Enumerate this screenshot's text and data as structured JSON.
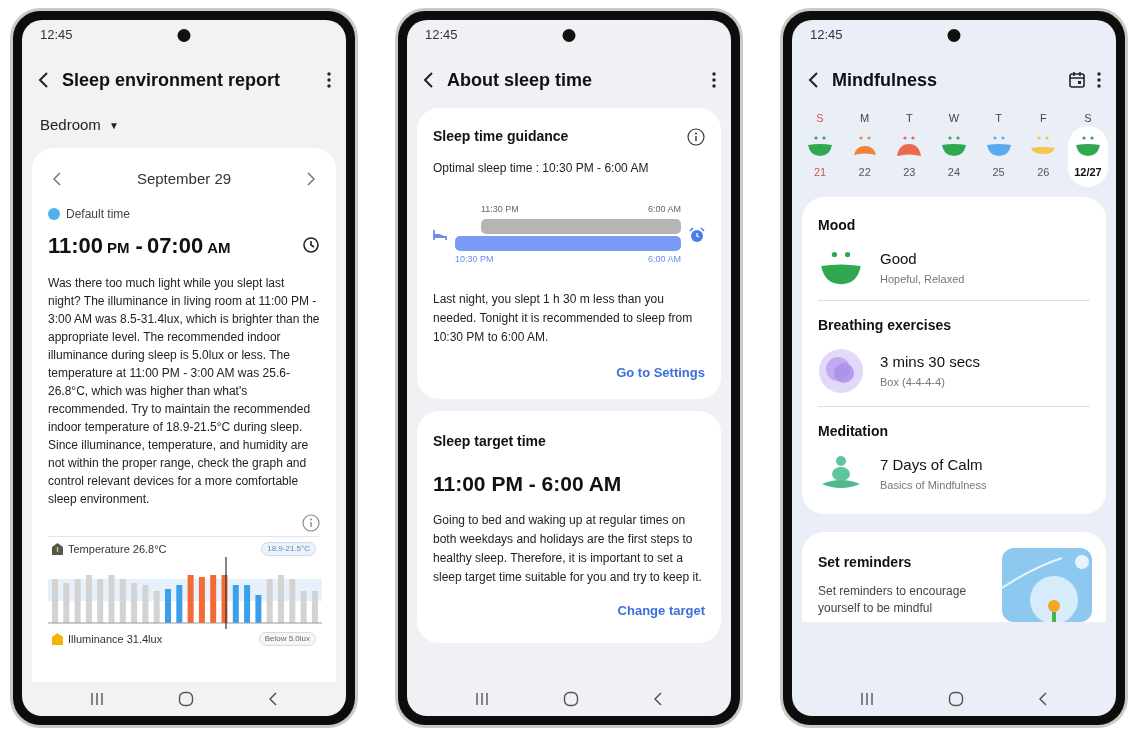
{
  "phones": [
    {
      "kind": "report",
      "status_time": "12:45",
      "title": "Sleep environment report",
      "room": "Bedroom",
      "room_caret": "▼",
      "date": "September 29",
      "default_label": "Default time",
      "time_range": {
        "start": "11:00",
        "start_period": "PM",
        "separator": "-",
        "end": "07:00",
        "end_period": "AM"
      },
      "paragraph": "Was there too much light while you slept last night? The illuminance in living room at 11:00 PM - 3:00 AM was 8.5-31.4lux, which is brighter than the appropriate level. The recommended indoor illuminance during sleep is 5.0lux or less. The temperature at 11:00 PM - 3:00 AM was 25.6-26.8°C, which was higher than what's recommended. Try to maintain the recommended indoor temperature of 18.9-21.5°C during sleep. Since illuminance, temperature, and humidity are not within the proper range, check the graph and control relevant devices for a more comfortable sleep environment.",
      "chart": {
        "temperature": "Temperature 26.8°C",
        "temperature_range": "18.9-21.5°C",
        "illuminance": "Illuminance 31.4lux",
        "illuminance_range": "Below 5.0lux"
      }
    },
    {
      "kind": "sleep_time",
      "status_time": "12:45",
      "title": "About sleep time",
      "guidance": {
        "title": "Sleep time guidance",
        "optimal": "Optimal sleep time : 10:30 PM - 6:00 AM",
        "actual_start": "11:30 PM",
        "actual_end": "6:00 AM",
        "target_start": "10:30 PM",
        "target_end": "6:00 AM",
        "text": "Last night, you slept 1 h 30 m less than you needed. Tonight it is recommended to sleep from 10:30 PM to 6:00 AM.",
        "link": "Go to Settings"
      },
      "target": {
        "title": "Sleep target time",
        "time": "11:00 PM - 6:00 AM",
        "text": "Going to bed and waking up at regular times on both weekdays and holidays are the first steps to healthy sleep. Therefore, it is important to set a sleep target time suitable for you and try to keep it.",
        "link": "Change target"
      }
    },
    {
      "kind": "mindfulness",
      "status_time": "12:45",
      "title": "Mindfulness",
      "days": [
        {
          "letter": "S",
          "date": "21",
          "kind": "smile",
          "color": "#2fa84f",
          "holiday": true,
          "selected": false
        },
        {
          "letter": "M",
          "date": "22",
          "kind": "frown",
          "color": "#f2843a",
          "holiday": false,
          "selected": false
        },
        {
          "letter": "T",
          "date": "23",
          "kind": "upset",
          "color": "#ea6a4e",
          "holiday": false,
          "selected": false
        },
        {
          "letter": "W",
          "date": "24",
          "kind": "smile",
          "color": "#2fa84f",
          "holiday": false,
          "selected": false
        },
        {
          "letter": "T",
          "date": "25",
          "kind": "smile",
          "color": "#5aaaf0",
          "holiday": false,
          "selected": false
        },
        {
          "letter": "F",
          "date": "26",
          "kind": "flat",
          "color": "#f6c54e",
          "holiday": false,
          "selected": false
        },
        {
          "letter": "S",
          "date": "12/27",
          "kind": "smile",
          "color": "#2fa84f",
          "holiday": false,
          "selected": true
        }
      ],
      "sections": [
        {
          "kind": "mood",
          "heading": "Mood",
          "title": "Good",
          "subtitle": "Hopeful, Relaxed"
        },
        {
          "kind": "breathing",
          "heading": "Breathing exercises",
          "title": "3 mins 30 secs",
          "subtitle": "Box (4-4-4-4)"
        },
        {
          "kind": "meditation",
          "heading": "Meditation",
          "title": "7 Days of Calm",
          "subtitle": "Basics of Mindfulness"
        }
      ],
      "reminder": {
        "title": "Set reminders",
        "text": "Set reminders to encourage yourself to be mindful"
      }
    }
  ]
}
